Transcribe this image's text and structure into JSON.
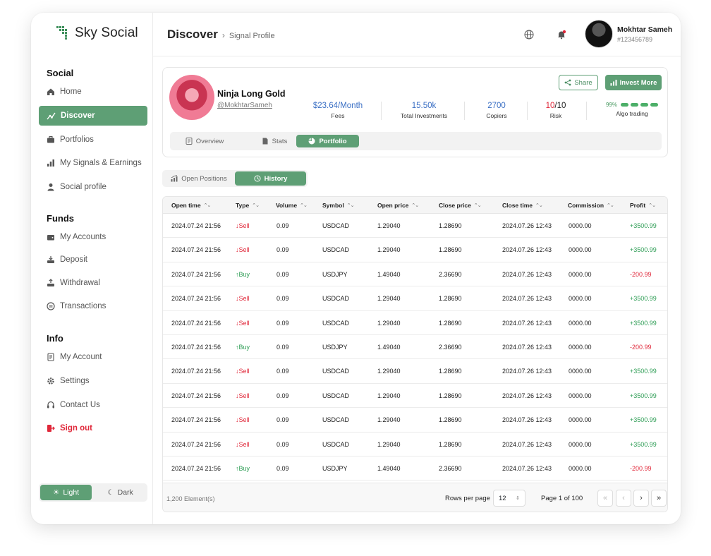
{
  "app": {
    "name": "Sky Social"
  },
  "sidebar": {
    "sections": [
      {
        "title": "Social",
        "items": [
          {
            "label": "Home",
            "icon": "home-icon"
          },
          {
            "label": "Discover",
            "icon": "discover-icon",
            "active": true
          },
          {
            "label": "Portfolios",
            "icon": "briefcase-icon"
          },
          {
            "label": "My Signals & Earnings",
            "icon": "bar-chart-icon"
          },
          {
            "label": "Social profile",
            "icon": "user-icon"
          }
        ]
      },
      {
        "title": "Funds",
        "items": [
          {
            "label": "My Accounts",
            "icon": "wallet-icon"
          },
          {
            "label": "Deposit",
            "icon": "deposit-icon"
          },
          {
            "label": "Withdrawal",
            "icon": "withdrawal-icon"
          },
          {
            "label": "Transactions",
            "icon": "transactions-icon"
          }
        ]
      },
      {
        "title": "Info",
        "items": [
          {
            "label": "My Account",
            "icon": "account-icon"
          },
          {
            "label": "Settings",
            "icon": "gear-icon"
          },
          {
            "label": "Contact Us",
            "icon": "headset-icon"
          },
          {
            "label": "Sign out",
            "icon": "sign-out-icon",
            "danger": true
          }
        ]
      }
    ],
    "theme": {
      "light": "Light",
      "dark": "Dark",
      "selected": "light"
    }
  },
  "header": {
    "title": "Discover",
    "subtitle": "Signal Profile",
    "user": {
      "name": "Mokhtar Sameh",
      "id": "#123456789"
    }
  },
  "profile": {
    "name": "Ninja Long Gold",
    "handle": "@MokhtarSameh",
    "stats": [
      {
        "value": "$23.64/Month",
        "label": "Fees"
      },
      {
        "value": "15.50k",
        "label": "Total Investments"
      },
      {
        "value": "2700",
        "label": "Copiers"
      }
    ],
    "risk": {
      "value": "10",
      "total": "/10",
      "label": "Risk"
    },
    "algo": {
      "percent": "99%",
      "level": 0.99,
      "label": "Algo trading"
    },
    "share_label": "Share",
    "invest_label": "Invest More",
    "tabs": [
      {
        "label": "Overview",
        "icon": "document-icon"
      },
      {
        "label": "Stats",
        "icon": "file-icon"
      },
      {
        "label": "Portfolio",
        "icon": "pie-icon",
        "active": true
      }
    ]
  },
  "subtabs": [
    {
      "label": "Open Positions",
      "icon": "chart-icon"
    },
    {
      "label": "History",
      "icon": "history-icon",
      "active": true
    }
  ],
  "table": {
    "columns": [
      "Open time",
      "Type",
      "Volume",
      "Symbol",
      "Open price",
      "Close price",
      "Close time",
      "Commission",
      "Profit"
    ],
    "rows": [
      {
        "open_time": "2024.07.24 21:56",
        "type": "Sell",
        "volume": "0.09",
        "symbol": "USDCAD",
        "open_price": "1.29040",
        "close_price": "1.28690",
        "close_time": "2024.07.26 12:43",
        "commission": "0000.00",
        "profit": "+3500.99"
      },
      {
        "open_time": "2024.07.24 21:56",
        "type": "Sell",
        "volume": "0.09",
        "symbol": "USDCAD",
        "open_price": "1.29040",
        "close_price": "1.28690",
        "close_time": "2024.07.26 12:43",
        "commission": "0000.00",
        "profit": "+3500.99"
      },
      {
        "open_time": "2024.07.24 21:56",
        "type": "Buy",
        "volume": "0.09",
        "symbol": "USDJPY",
        "open_price": "1.49040",
        "close_price": "2.36690",
        "close_time": "2024.07.26 12:43",
        "commission": "0000.00",
        "profit": "-200.99"
      },
      {
        "open_time": "2024.07.24 21:56",
        "type": "Sell",
        "volume": "0.09",
        "symbol": "USDCAD",
        "open_price": "1.29040",
        "close_price": "1.28690",
        "close_time": "2024.07.26 12:43",
        "commission": "0000.00",
        "profit": "+3500.99"
      },
      {
        "open_time": "2024.07.24 21:56",
        "type": "Sell",
        "volume": "0.09",
        "symbol": "USDCAD",
        "open_price": "1.29040",
        "close_price": "1.28690",
        "close_time": "2024.07.26 12:43",
        "commission": "0000.00",
        "profit": "+3500.99"
      },
      {
        "open_time": "2024.07.24 21:56",
        "type": "Buy",
        "volume": "0.09",
        "symbol": "USDJPY",
        "open_price": "1.49040",
        "close_price": "2.36690",
        "close_time": "2024.07.26 12:43",
        "commission": "0000.00",
        "profit": "-200.99"
      },
      {
        "open_time": "2024.07.24 21:56",
        "type": "Sell",
        "volume": "0.09",
        "symbol": "USDCAD",
        "open_price": "1.29040",
        "close_price": "1.28690",
        "close_time": "2024.07.26 12:43",
        "commission": "0000.00",
        "profit": "+3500.99"
      },
      {
        "open_time": "2024.07.24 21:56",
        "type": "Sell",
        "volume": "0.09",
        "symbol": "USDCAD",
        "open_price": "1.29040",
        "close_price": "1.28690",
        "close_time": "2024.07.26 12:43",
        "commission": "0000.00",
        "profit": "+3500.99"
      },
      {
        "open_time": "2024.07.24 21:56",
        "type": "Sell",
        "volume": "0.09",
        "symbol": "USDCAD",
        "open_price": "1.29040",
        "close_price": "1.28690",
        "close_time": "2024.07.26 12:43",
        "commission": "0000.00",
        "profit": "+3500.99"
      },
      {
        "open_time": "2024.07.24 21:56",
        "type": "Sell",
        "volume": "0.09",
        "symbol": "USDCAD",
        "open_price": "1.29040",
        "close_price": "1.28690",
        "close_time": "2024.07.26 12:43",
        "commission": "0000.00",
        "profit": "+3500.99"
      },
      {
        "open_time": "2024.07.24 21:56",
        "type": "Buy",
        "volume": "0.09",
        "symbol": "USDJPY",
        "open_price": "1.49040",
        "close_price": "2.36690",
        "close_time": "2024.07.26 12:43",
        "commission": "0000.00",
        "profit": "-200.99"
      }
    ],
    "footer": {
      "count": "1,200 Element(s)",
      "rows_per_page_label": "Rows per page",
      "rows_per_page": "12",
      "page_info": "Page 1 of 100"
    }
  },
  "colors": {
    "accent": "#5e9f75",
    "danger": "#e0283a",
    "positive": "#2e9d55",
    "link": "#3a6fc4"
  }
}
